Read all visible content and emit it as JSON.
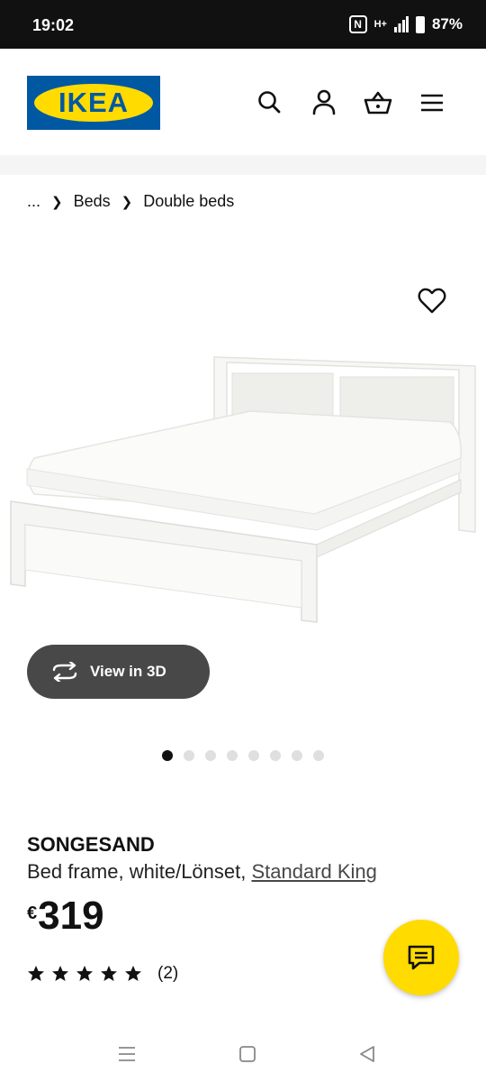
{
  "status_bar": {
    "time": "19:02",
    "nfc_label": "N",
    "network_label": "H+",
    "battery": "87%"
  },
  "header": {
    "logo_text": "IKEA",
    "icons": [
      "search-icon",
      "account-icon",
      "basket-icon",
      "menu-icon"
    ]
  },
  "breadcrumb": {
    "ellipsis": "...",
    "items": [
      "Beds",
      "Double beds"
    ]
  },
  "gallery": {
    "view_3d_label": "View in 3D",
    "total_images": 8,
    "active_index": 0
  },
  "product": {
    "name": "SONGESAND",
    "description": "Bed frame, white/Lönset, ",
    "size": "Standard King",
    "currency": "€",
    "price": "319",
    "rating_value": 5,
    "review_count": "(2)"
  },
  "colors": {
    "ikea_blue": "#0058a3",
    "ikea_yellow": "#ffdb00",
    "button_dark": "#484848"
  }
}
